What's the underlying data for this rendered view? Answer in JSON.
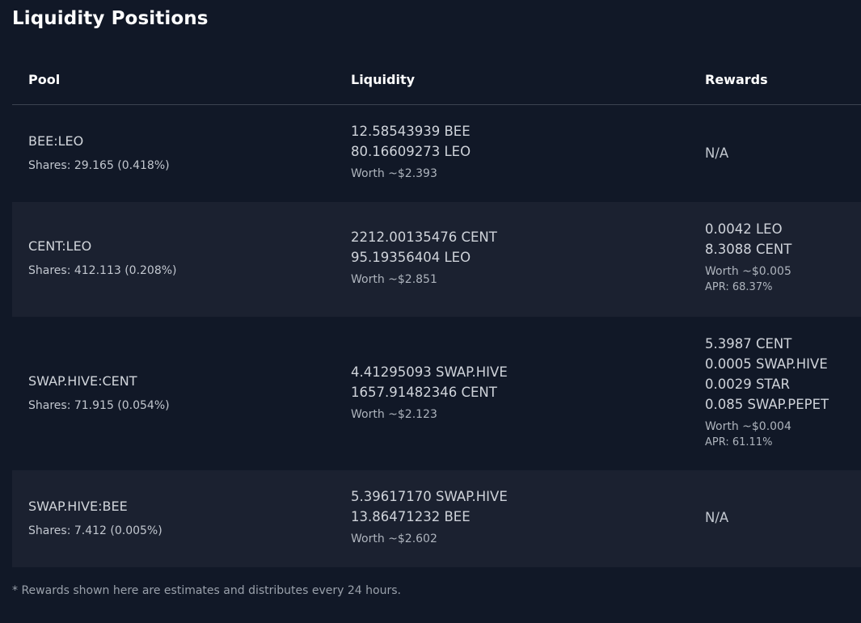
{
  "page": {
    "title": "Liquidity Positions",
    "footnote": "* Rewards shown here are estimates and distributes every 24 hours."
  },
  "table": {
    "headers": {
      "pool": "Pool",
      "liquidity": "Liquidity",
      "rewards": "Rewards"
    },
    "rows": [
      {
        "pool": "BEE:LEO",
        "shares": "Shares: 29.165 (0.418%)",
        "liquidity": [
          "12.58543939 BEE",
          "80.16609273 LEO"
        ],
        "liquidity_worth": "Worth ~$2.393",
        "rewards": [],
        "rewards_na": "N/A",
        "rewards_worth": "",
        "apr": ""
      },
      {
        "pool": "CENT:LEO",
        "shares": "Shares: 412.113 (0.208%)",
        "liquidity": [
          "2212.00135476 CENT",
          "95.19356404 LEO"
        ],
        "liquidity_worth": "Worth ~$2.851",
        "rewards": [
          "0.0042 LEO",
          "8.3088 CENT"
        ],
        "rewards_na": "",
        "rewards_worth": "Worth ~$0.005",
        "apr": "APR: 68.37%"
      },
      {
        "pool": "SWAP.HIVE:CENT",
        "shares": "Shares: 71.915 (0.054%)",
        "liquidity": [
          "4.41295093 SWAP.HIVE",
          "1657.91482346 CENT"
        ],
        "liquidity_worth": "Worth ~$2.123",
        "rewards": [
          "5.3987 CENT",
          "0.0005 SWAP.HIVE",
          "0.0029 STAR",
          "0.085 SWAP.PEPET"
        ],
        "rewards_na": "",
        "rewards_worth": "Worth ~$0.004",
        "apr": "APR: 61.11%"
      },
      {
        "pool": "SWAP.HIVE:BEE",
        "shares": "Shares: 7.412 (0.005%)",
        "liquidity": [
          "5.39617170 SWAP.HIVE",
          "13.86471232 BEE"
        ],
        "liquidity_worth": "Worth ~$2.602",
        "rewards": [],
        "rewards_na": "N/A",
        "rewards_worth": "",
        "apr": ""
      }
    ]
  }
}
